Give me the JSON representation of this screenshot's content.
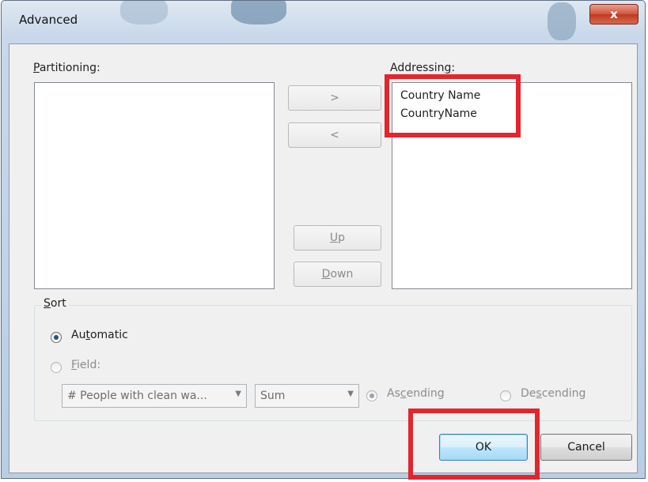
{
  "window": {
    "title": "Advanced",
    "close_label": "x"
  },
  "partitioning": {
    "label_prefix": "P",
    "label_rest": "artitioning:",
    "items": []
  },
  "addressing": {
    "label_prefix": "A",
    "label_mid": "ddressin",
    "label_u": "g",
    "label_end": ":",
    "items": [
      "Country Name",
      "CountryName"
    ]
  },
  "buttons": {
    "move_right": ">",
    "move_left": "<",
    "up_u": "U",
    "up_rest": "p",
    "down_u": "D",
    "down_rest": "own",
    "ok": "OK",
    "cancel": "Cancel"
  },
  "sort": {
    "group_u": "S",
    "group_rest": "ort",
    "automatic_pre": "Au",
    "automatic_u": "t",
    "automatic_post": "omatic",
    "field_u": "F",
    "field_rest": "ield:",
    "field_select": "# People with clean wa...",
    "aggregation_select": "Sum",
    "ascending_pre": "As",
    "ascending_u": "c",
    "ascending_post": "ending",
    "descending_pre": "De",
    "descending_u": "s",
    "descending_post": "cending"
  },
  "colors": {
    "highlight": "#e4252d",
    "default_button_border": "#3c7fb1"
  }
}
